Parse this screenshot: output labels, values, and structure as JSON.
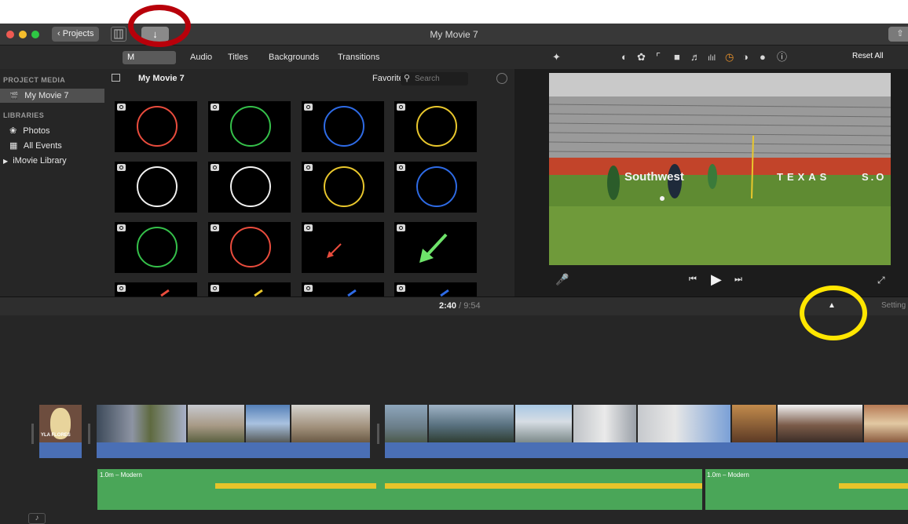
{
  "window": {
    "title": "My Movie 7",
    "projects_label": "Projects",
    "import_glyph": "↓"
  },
  "tabs": {
    "items": [
      "My Media",
      "Audio",
      "Titles",
      "Backgrounds",
      "Transitions"
    ],
    "active_visible_text": "M"
  },
  "sidebar": {
    "project_media_heading": "PROJECT MEDIA",
    "project_item": "My Movie 7",
    "libraries_heading": "LIBRARIES",
    "photos": "Photos",
    "all_events": "All Events",
    "library": "iMovie Library"
  },
  "media_header": {
    "title": "My Movie 7",
    "filter": "Favorites",
    "search_placeholder": "Search"
  },
  "viewer": {
    "reset_all": "Reset All"
  },
  "timeline": {
    "current_time": "2:40",
    "total_time": "9:54",
    "separator": "/",
    "settings_label": "Setting",
    "music_label": "1.0m – Modern",
    "music_label_2": "1.0m – Modern",
    "title_clip_text": "YLA FLORES"
  },
  "stadium_text": {
    "sponsor": "Southwest",
    "texas": "TEXAS",
    "so": "S.O"
  },
  "colors": {
    "red_ring": "#e94c3d",
    "green_ring": "#35c04a",
    "blue_ring": "#2e6be6",
    "yellow_ring": "#e9c72c",
    "white_ring": "#f2f2f2",
    "annotation_red": "#b8000a",
    "annotation_yellow": "#ffe600"
  },
  "icons": {
    "magic_wand": "magic-wand-icon",
    "color_balance": "color-balance-icon",
    "palette": "color-palette-icon",
    "crop": "crop-icon",
    "stabilize": "camera-stabilize-icon",
    "volume": "volume-icon",
    "equalizer": "equalizer-icon",
    "speed": "speed-icon",
    "noise": "noise-reduction-icon",
    "filter": "clip-filter-icon",
    "info": "info-icon",
    "microphone": "microphone-icon",
    "previous": "skip-back-icon",
    "play": "play-icon",
    "next": "skip-forward-icon",
    "fullscreen": "fullscreen-icon"
  }
}
